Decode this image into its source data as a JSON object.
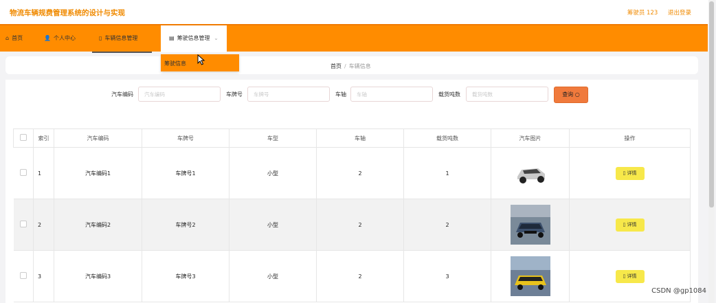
{
  "app": {
    "title": "物流车辆规费管理系统的设计与实现"
  },
  "user": {
    "name": "筹驶员 123",
    "logout": "退出登录"
  },
  "nav": {
    "home": "首页",
    "profile": "个人中心",
    "vehicle_info": "车辆信息管理",
    "driver_info": "筹驶信息管理",
    "caret": "⌄"
  },
  "dropdown": {
    "item": "筹驶信息"
  },
  "breadcrumb": {
    "home": "首页",
    "sep": "/",
    "current": "车辆信息"
  },
  "search": {
    "car_code_label": "汽车编码",
    "car_code_placeholder": "汽车编码",
    "plate_label": "车牌号",
    "plate_placeholder": "车牌号",
    "axle_label": "车轴",
    "axle_placeholder": "车轴",
    "load_label": "载货吨数",
    "load_placeholder": "载货吨数",
    "button": "查询 ○"
  },
  "table": {
    "headers": [
      "索引",
      "汽车编码",
      "车牌号",
      "车型",
      "车轴",
      "载货吨数",
      "汽车图片",
      "操作"
    ],
    "rows": [
      {
        "index": "1",
        "code": "汽车编码1",
        "plate": "车牌号1",
        "type": "小型",
        "axle": "2",
        "load": "1",
        "action": "详情"
      },
      {
        "index": "2",
        "code": "汽车编码2",
        "plate": "车牌号2",
        "type": "小型",
        "axle": "2",
        "load": "2",
        "action": "详情"
      },
      {
        "index": "3",
        "code": "汽车编码3",
        "plate": "车牌号3",
        "type": "小型",
        "axle": "2",
        "load": "3",
        "action": "详情"
      }
    ]
  },
  "watermark": "CSDN @gp1084",
  "colors": {
    "accent": "#ff8c00",
    "title": "#f08a00",
    "detail_button": "#f7e84a",
    "search_button": "#f07a3c"
  }
}
